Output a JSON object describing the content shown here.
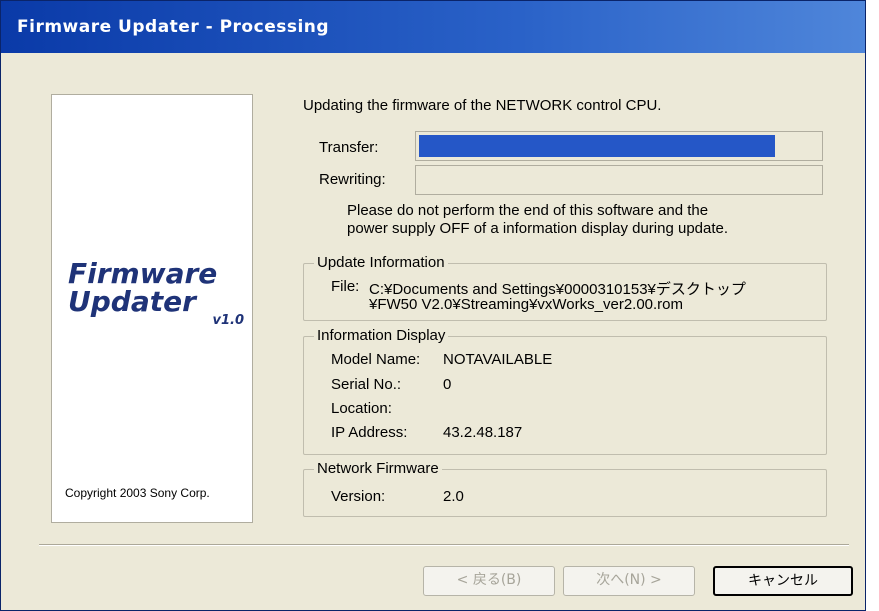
{
  "window": {
    "title": "Firmware Updater - Processing"
  },
  "logo": {
    "line1": "Firmware",
    "line2": "Updater",
    "version": "v1.0",
    "copyright": "Copyright 2003 Sony Corp."
  },
  "main": {
    "heading": "Updating the firmware of the NETWORK control CPU."
  },
  "progress": {
    "transfer_label": "Transfer:",
    "transfer_fraction": 0.89,
    "rewriting_label": "Rewriting:",
    "rewriting_fraction": 0.0
  },
  "warning": {
    "line1": "Please do not perform the end of this software and the",
    "line2": "power supply OFF of a information display during update."
  },
  "update_info": {
    "title": "Update Information",
    "file_label": "File:",
    "file_line1": "C:¥Documents and Settings¥0000310153¥デスクトップ",
    "file_line2": "¥FW50 V2.0¥Streaming¥vxWorks_ver2.00.rom"
  },
  "info_display": {
    "title": "Information Display",
    "model_label": "Model Name:",
    "model_value": "NOTAVAILABLE",
    "serial_label": "Serial No.:",
    "serial_value": "0",
    "location_label": "Location:",
    "location_value": "",
    "ip_label": "IP Address:",
    "ip_value": "43.2.48.187"
  },
  "network_fw": {
    "title": "Network Firmware",
    "version_label": "Version:",
    "version_value": "2.0"
  },
  "buttons": {
    "back": "< 戻る(B)",
    "next": "次へ(N) >",
    "cancel": "キャンセル"
  },
  "colors": {
    "title_bar": "#0a3aa8",
    "progress_fill": "#2557c7",
    "logo_text": "#1f3378",
    "window_bg": "#ece9d8"
  }
}
